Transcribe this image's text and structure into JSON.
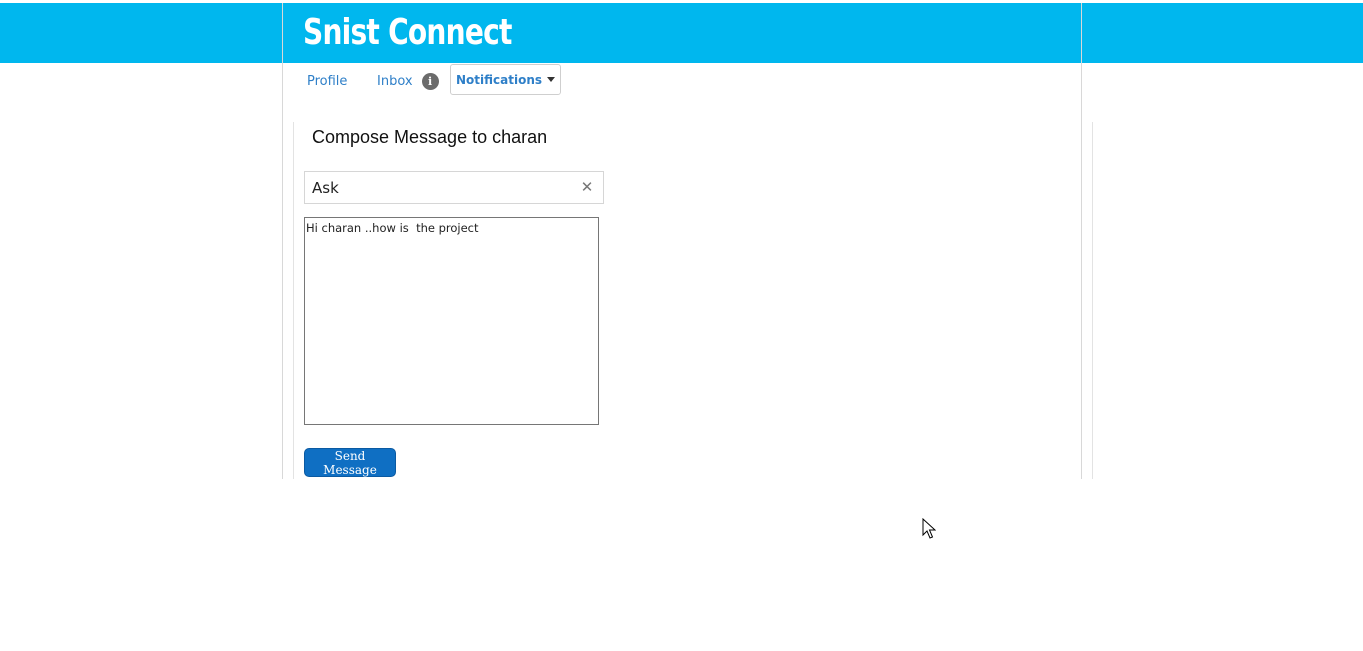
{
  "theme": {
    "accent": "#00b7ee",
    "link": "#2e7fc8",
    "button": "#0f6fc3"
  },
  "header": {
    "brand": "Snist Connect"
  },
  "nav": {
    "profile": "Profile",
    "inbox": "Inbox",
    "inbox_info_glyph": "i",
    "notifications": "Notifications"
  },
  "compose": {
    "title": "Compose Message to charan",
    "subject_value": "Ask",
    "clear_glyph": "✕",
    "body_value": "Hi charan ..how is  the project",
    "send_label": "Send Message"
  },
  "icons": {
    "info": "info-icon",
    "caret": "caret-down-icon",
    "clear": "clear-icon",
    "cursor": "mouse-pointer-icon"
  }
}
